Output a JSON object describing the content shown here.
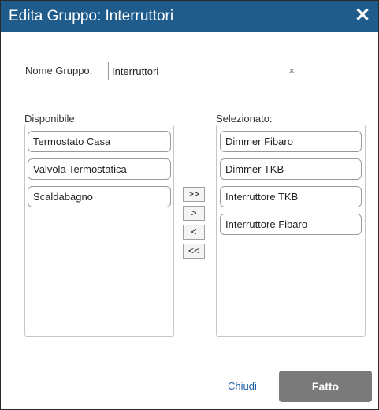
{
  "dialog": {
    "title": "Edita Gruppo: Interruttori",
    "close_icon": "close-icon"
  },
  "name": {
    "label": "Nome Gruppo:",
    "value": "Interruttori",
    "clear_glyph": "×"
  },
  "available": {
    "label": "Disponibile:",
    "items": [
      "Termostato Casa",
      "Valvola Termostatica",
      "Scaldabagno"
    ]
  },
  "selected": {
    "label": "Selezionato:",
    "items": [
      "Dimmer Fibaro",
      "Dimmer TKB",
      "Interruttore TKB",
      "Interruttore Fibaro"
    ]
  },
  "move_buttons": {
    "add_all": ">>",
    "add": ">",
    "remove": "<",
    "remove_all": "<<"
  },
  "footer": {
    "close_label": "Chiudi",
    "done_label": "Fatto"
  },
  "colors": {
    "titlebar": "#1f5c8c",
    "done_button": "#7a7a7a",
    "link": "#1f5fa8"
  }
}
